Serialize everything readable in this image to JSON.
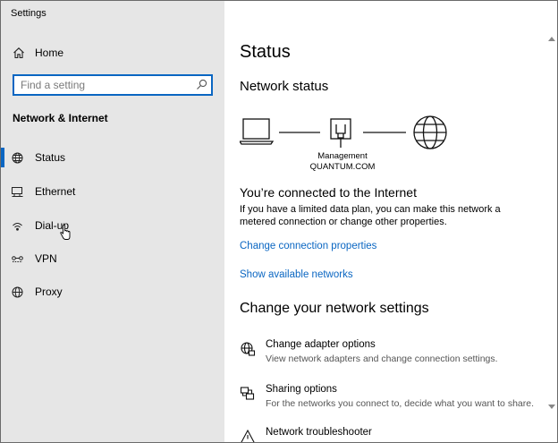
{
  "window": {
    "title": "Settings",
    "controls": [
      "minimize-icon",
      "maximize-icon",
      "close-icon"
    ]
  },
  "sidebar": {
    "home_label": "Home",
    "search": {
      "placeholder": "Find a setting",
      "value": ""
    },
    "section_title": "Network & Internet",
    "items": [
      {
        "label": "Status",
        "icon": "globe-icon",
        "active": true
      },
      {
        "label": "Ethernet",
        "icon": "ethernet-icon",
        "active": false
      },
      {
        "label": "Dial-up",
        "icon": "dialup-icon",
        "active": false
      },
      {
        "label": "VPN",
        "icon": "vpn-icon",
        "active": false
      },
      {
        "label": "Proxy",
        "icon": "globe-icon",
        "active": false
      }
    ]
  },
  "main": {
    "title": "Status",
    "network_status_heading": "Network status",
    "network": {
      "name": "Management",
      "domain": "QUANTUM.COM"
    },
    "connected_heading": "You’re connected to the Internet",
    "connected_desc": "If you have a limited data plan, you can make this network a metered connection or change other properties.",
    "links": {
      "change_connection": "Change connection properties",
      "show_networks": "Show available networks"
    },
    "change_heading": "Change your network settings",
    "options": [
      {
        "title": "Change adapter options",
        "subtitle": "View network adapters and change connection settings.",
        "icon": "adapter-icon"
      },
      {
        "title": "Sharing options",
        "subtitle": "For the networks you connect to, decide what you want to share.",
        "icon": "sharing-icon"
      },
      {
        "title": "Network troubleshooter",
        "subtitle": "",
        "icon": "warning-icon"
      }
    ]
  },
  "colors": {
    "accent": "#0a66c2",
    "sidebar_bg": "#e6e6e6",
    "content_bg": "#ffffff"
  }
}
